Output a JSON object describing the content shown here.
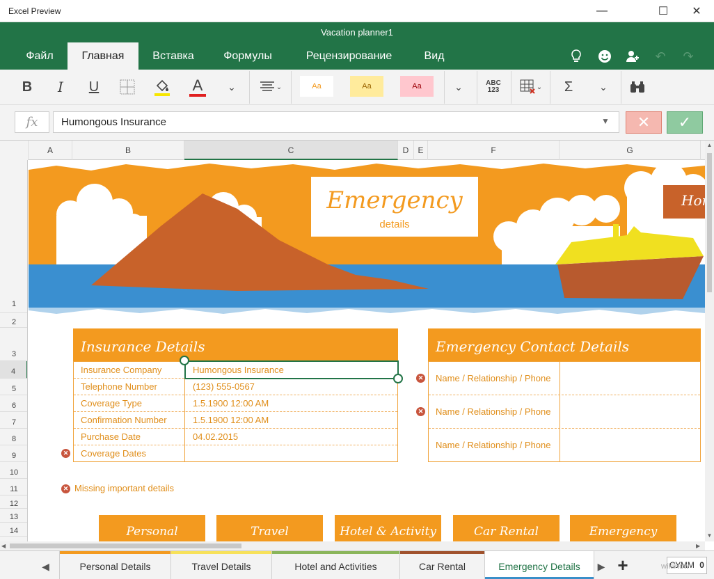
{
  "window": {
    "app_title": "Excel Preview",
    "doc_title": "Vacation planner1"
  },
  "tabs": [
    {
      "label": "Файл"
    },
    {
      "label": "Главная"
    },
    {
      "label": "Вставка"
    },
    {
      "label": "Формулы"
    },
    {
      "label": "Рецензирование"
    },
    {
      "label": "Вид"
    }
  ],
  "ribbon": {
    "bold": "B",
    "italic": "I",
    "underline": "U",
    "font_color": "A",
    "styles": [
      "Aa",
      "Aa",
      "Aa"
    ],
    "number_format": "ABC\n123",
    "autosum": "Σ"
  },
  "formula_bar": {
    "fx": "fx",
    "value": "Humongous Insurance"
  },
  "columns": [
    "A",
    "B",
    "C",
    "D",
    "E",
    "F",
    "G"
  ],
  "rows": [
    "1",
    "2",
    "3",
    "4",
    "5",
    "6",
    "7",
    "8",
    "9",
    "10",
    "11",
    "12",
    "13",
    "14"
  ],
  "banner": {
    "title": "Emergency",
    "subtitle": "details",
    "right_tag": "Hom"
  },
  "insurance": {
    "title": "Insurance Details",
    "rows": [
      {
        "label": "Insurance Company",
        "value": "Humongous Insurance"
      },
      {
        "label": "Telephone Number",
        "value": "(123) 555-0567"
      },
      {
        "label": "Coverage Type",
        "value": "1.5.1900 12:00 AM"
      },
      {
        "label": "Confirmation Number",
        "value": "1.5.1900 12:00 AM"
      },
      {
        "label": "Purchase Date",
        "value": "04.02.2015"
      },
      {
        "label": "Coverage Dates",
        "value": ""
      }
    ]
  },
  "contacts": {
    "title": "Emergency Contact Details",
    "rows": [
      {
        "label": "Name / Relationship / Phone"
      },
      {
        "label": "Name / Relationship / Phone"
      },
      {
        "label": "Name / Relationship / Phone"
      }
    ]
  },
  "missing_note": "Missing important details",
  "nav_tiles": [
    "Personal",
    "Travel",
    "Hotel & Activity",
    "Car Rental",
    "Emergency"
  ],
  "sheet_tabs": [
    {
      "label": "Personal Details",
      "color": "#f39a1f"
    },
    {
      "label": "Travel Details",
      "color": "#f7e15a"
    },
    {
      "label": "Hotel and Activities",
      "color": "#8ab55a"
    },
    {
      "label": "Car Rental",
      "color": "#a0522d"
    },
    {
      "label": "Emergency Details",
      "color": "#3a8fc9"
    }
  ],
  "status": {
    "sum_label": "СУММ",
    "sum_value": "0",
    "watermark": "wikiHow"
  },
  "colors": {
    "accent": "#227447",
    "orange": "#f39a1f",
    "sea": "#3a8fd0",
    "mountain": "#c8622a"
  }
}
